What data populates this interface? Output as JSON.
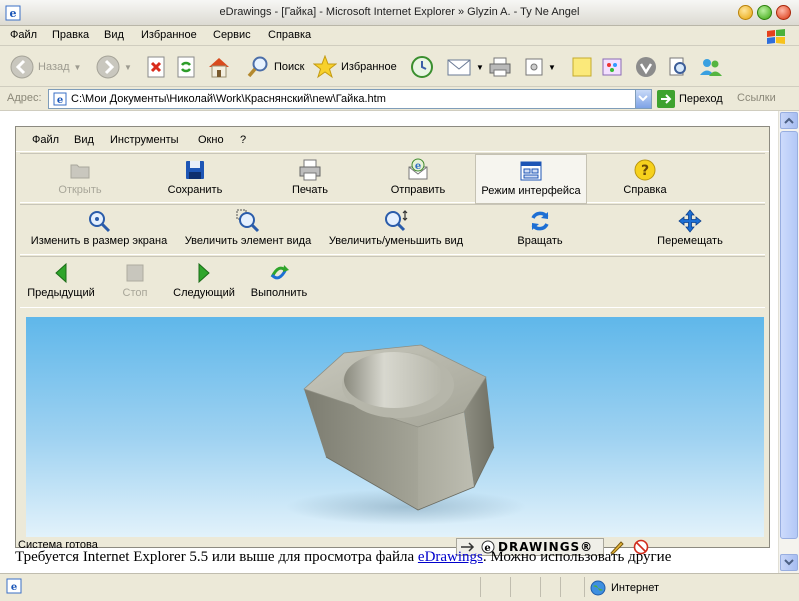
{
  "window": {
    "title": "eDrawings - [Гайка] - Microsoft Internet Explorer   » Glyzin A. - Ty Ne Angel"
  },
  "menu": [
    "Файл",
    "Правка",
    "Вид",
    "Избранное",
    "Сервис",
    "Справка"
  ],
  "toolbar": {
    "back": "Назад",
    "search": "Поиск",
    "favorites": "Избранное"
  },
  "address": {
    "label": "Адрес:",
    "url": "C:\\Мои Документы\\Николай\\Work\\Краснянский\\new\\Гайка.htm",
    "go": "Переход",
    "links": "Ссылки"
  },
  "edrawings": {
    "menu": [
      "Файл",
      "Вид",
      "Инструменты",
      "Окно",
      "?"
    ],
    "row1": [
      "Открыть",
      "Сохранить",
      "Печать",
      "Отправить",
      "Режим интерфейса",
      "Справка"
    ],
    "row2": [
      "Изменить в размер экрана",
      "Увеличить элемент вида",
      "Увеличить/уменьшить вид",
      "Вращать",
      "Перемещать"
    ],
    "row3": [
      "Предыдущий",
      "Стоп",
      "Следующий",
      "Выполнить"
    ],
    "status": "Система готова",
    "logo": "DRAWINGS®"
  },
  "notice": {
    "before": "Требуется Internet Explorer 5.5 или выше для просмотра файла ",
    "link": "eDrawings",
    "after": ". Можно использовать другие"
  },
  "statusbar": {
    "zone": "Интернет"
  },
  "colors": {
    "accent": "#316ac5",
    "sky_top": "#5fb7ea",
    "sky_bottom": "#e2f2fb"
  }
}
